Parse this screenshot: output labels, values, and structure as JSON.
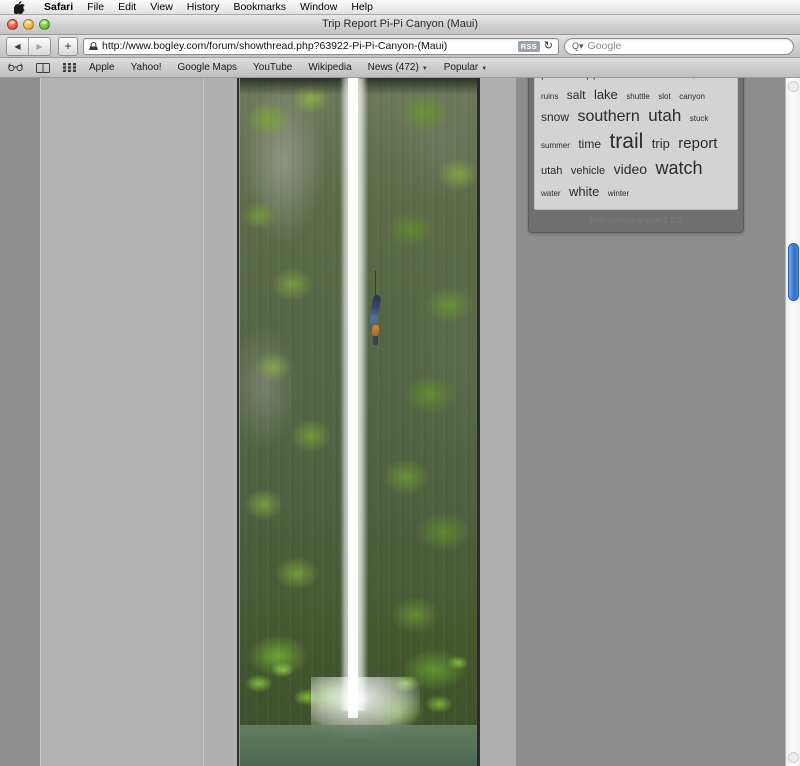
{
  "menubar": {
    "apple_icon": "apple-logo-icon",
    "items": [
      {
        "label": "Safari",
        "bold": true
      },
      {
        "label": "File",
        "bold": false
      },
      {
        "label": "Edit",
        "bold": false
      },
      {
        "label": "View",
        "bold": false
      },
      {
        "label": "History",
        "bold": false
      },
      {
        "label": "Bookmarks",
        "bold": false
      },
      {
        "label": "Window",
        "bold": false
      },
      {
        "label": "Help",
        "bold": false
      }
    ]
  },
  "window": {
    "title": "Trip Report Pi-Pi Canyon (Maui)",
    "controls": {
      "close": "close-button",
      "minimize": "minimize-button",
      "zoom": "zoom-button"
    }
  },
  "toolbar": {
    "back_glyph": "◀",
    "forward_glyph": "▶",
    "add_glyph": "+",
    "site_icon": "padlock-site-icon",
    "url": "http://www.bogley.com/forum/showthread.php?63922-Pi-Pi-Canyon-(Maui)",
    "rss_label": "RSS",
    "reload_glyph": "↻",
    "search_glyph": "Q▾",
    "search_value": "",
    "search_placeholder": "Google"
  },
  "bookmarks_bar": {
    "icons": [
      "reading-glasses-icon",
      "book-icon",
      "grid-icon"
    ],
    "items": [
      {
        "label": "Apple",
        "has_menu": false
      },
      {
        "label": "Yahoo!",
        "has_menu": false
      },
      {
        "label": "Google Maps",
        "has_menu": false
      },
      {
        "label": "YouTube",
        "has_menu": false
      },
      {
        "label": "Wikipedia",
        "has_menu": false
      },
      {
        "label": "News (472)",
        "has_menu": true
      },
      {
        "label": "Popular",
        "has_menu": true
      }
    ]
  },
  "page": {
    "photo": {
      "alt": "Tall waterfall cascading down a mossy green cliff with a canyoneer rappelling beside it"
    },
    "tag_cloud": {
      "footer": "Everywhere global 1.5.1",
      "tags": [
        {
          "label": "point",
          "size": 12
        },
        {
          "label": "rappel",
          "size": 12
        },
        {
          "label": "river",
          "size": 8
        },
        {
          "label": "rocks",
          "size": 15
        },
        {
          "label": "rope",
          "size": 8
        },
        {
          "label": "ruins",
          "size": 8
        },
        {
          "label": "salt",
          "size": 12
        },
        {
          "label": "lake",
          "size": 13
        },
        {
          "label": "shuttle",
          "size": 8
        },
        {
          "label": "slot",
          "size": 8
        },
        {
          "label": "canyon",
          "size": 8
        },
        {
          "label": "snow",
          "size": 12
        },
        {
          "label": "southern",
          "size": 16
        },
        {
          "label": "utah",
          "size": 17
        },
        {
          "label": "stuck",
          "size": 8
        },
        {
          "label": "summer",
          "size": 8
        },
        {
          "label": "time",
          "size": 12
        },
        {
          "label": "trail",
          "size": 21
        },
        {
          "label": "trip",
          "size": 13
        },
        {
          "label": "report",
          "size": 15
        },
        {
          "label": "utah",
          "size": 11
        },
        {
          "label": "vehicle",
          "size": 11
        },
        {
          "label": "video",
          "size": 14
        },
        {
          "label": "watch",
          "size": 18
        },
        {
          "label": "water",
          "size": 8
        },
        {
          "label": "white",
          "size": 13
        },
        {
          "label": "winter",
          "size": 8
        }
      ]
    },
    "scrollbar": {
      "name": "vertical-scrollbar"
    }
  }
}
